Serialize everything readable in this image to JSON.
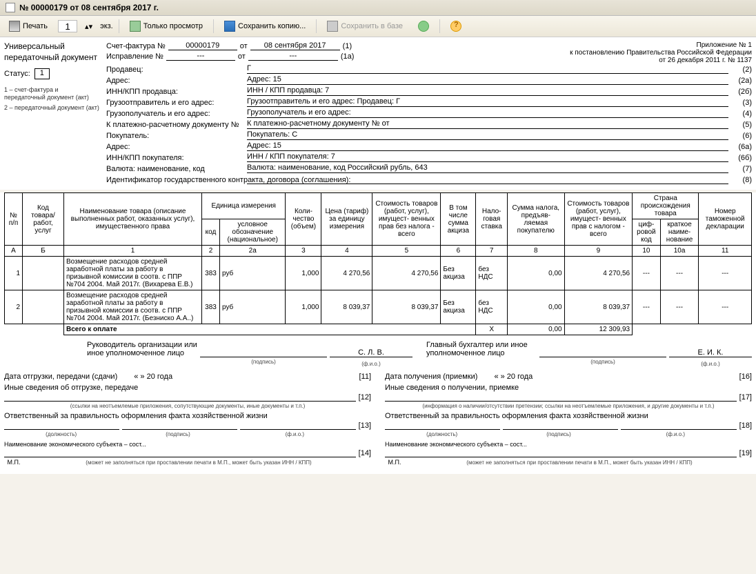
{
  "window": {
    "title": "№ 00000179 от 08 сентября 2017 г."
  },
  "toolbar": {
    "print": "Печать",
    "copies": "1",
    "copies_unit": "экз.",
    "view_only": "Только просмотр",
    "save_copy": "Сохранить копию...",
    "save_db": "Сохранить в базе"
  },
  "left": {
    "title": "Универсальный передаточный документ",
    "status_label": "Статус:",
    "status_value": "1",
    "note1": "1 – счет-фактура и передаточный документ (акт)",
    "note2": "2 – передаточный документ (акт)"
  },
  "header": {
    "invoice_label": "Счет-фактура №",
    "invoice_no": "00000179",
    "from": "от",
    "invoice_date": "08 сентября 2017",
    "invoice_suffix": "(1)",
    "correction_label": "Исправление №",
    "correction_no": "---",
    "correction_date": "---",
    "correction_suffix": "(1а)",
    "attach1": "Приложение № 1",
    "attach2": "к постановлению Правительства Российской Федерации",
    "attach3": "от 26 декабря 2011 г. № 1137"
  },
  "fields": {
    "seller": {
      "label": "Продавец:",
      "value": "Г",
      "suffix": "(2)"
    },
    "address": {
      "label": "Адрес:",
      "value": "Адрес: 15",
      "suffix": "(2а)"
    },
    "inn_seller": {
      "label": "ИНН/КПП продавца:",
      "value": "ИНН / КПП продавца: 7",
      "suffix": "(2б)"
    },
    "shipper": {
      "label": "Грузоотправитель и его адрес:",
      "value": "Грузоотправитель и его адрес: Продавец: Г",
      "suffix": "(3)"
    },
    "consignee": {
      "label": "Грузополучатель и его адрес:",
      "value": "Грузополучатель и его адрес:",
      "suffix": "(4)"
    },
    "paydoc": {
      "label": "К платежно-расчетному документу №",
      "value": "К платежно-расчетному документу №                              от",
      "suffix": "(5)"
    },
    "buyer": {
      "label": "Покупатель:",
      "value": "Покупатель: С",
      "suffix": "(6)"
    },
    "buyer_addr": {
      "label": "Адрес:",
      "value": "Адрес: 15",
      "suffix": "(6а)"
    },
    "inn_buyer": {
      "label": "ИНН/КПП покупателя:",
      "value": "ИНН / КПП покупателя: 7",
      "suffix": "(6б)"
    },
    "currency": {
      "label": "Валюта: наименование, код",
      "value": "Валюта: наименование, код Российский рубль, 643",
      "suffix": "(7)"
    },
    "contract": {
      "label": "Идентификатор государственного контракта, договора (соглашения):",
      "value": "",
      "suffix": "(8)"
    }
  },
  "table": {
    "headers": {
      "a": "№ п/п",
      "b": "Код товара/ работ, услуг",
      "c1": "Наименование товара (описание выполненных работ, оказанных услуг), имущественного права",
      "c2": "Единица измерения",
      "c2a": "код",
      "c2b": "условное обозначение (национальное)",
      "c3": "Коли- чество (объем)",
      "c4": "Цена (тариф) за единицу измерения",
      "c5": "Стоимость товаров (работ, услуг), имущест- венных прав без налога - всего",
      "c6": "В том числе сумма акциза",
      "c7": "Нало- говая ставка",
      "c8": "Сумма налога, предъяв- ляемая покупателю",
      "c9": "Стоимость товаров (работ, услуг), имущест- венных прав с налогом - всего",
      "c10g": "Страна происхождения товара",
      "c10": "циф- ровой код",
      "c10a": "краткое наиме- нование",
      "c11": "Номер таможенной декларации"
    },
    "numrow": {
      "a": "А",
      "b": "Б",
      "c1": "1",
      "c2": "2",
      "c2a": "2а",
      "c3": "3",
      "c4": "4",
      "c5": "5",
      "c6": "6",
      "c7": "7",
      "c8": "8",
      "c9": "9",
      "c10": "10",
      "c10a": "10а",
      "c11": "11"
    },
    "rows": [
      {
        "n": "1",
        "code": "",
        "name": "Возмещение расходов средней заработной платы за работу в призывной комиссии в соотв. с ППР №704 2004. Май 2017г. (Вихарева Е.В.)",
        "ucode": "383",
        "uname": "руб",
        "qty": "1,000",
        "price": "4 270,56",
        "sum_no_tax": "4 270,56",
        "excise": "Без акциза",
        "rate": "без НДС",
        "tax": "0,00",
        "sum_tax": "4 270,56",
        "ccode": "---",
        "cname": "---",
        "decl": "---"
      },
      {
        "n": "2",
        "code": "",
        "name": "Возмещение расходов средней заработной платы за работу в призывной комиссии в соотв. с ППР №704 2004. Май 2017г. (Безниско А.А..)",
        "ucode": "383",
        "uname": "руб",
        "qty": "1,000",
        "price": "8 039,37",
        "sum_no_tax": "8 039,37",
        "excise": "Без акциза",
        "rate": "без НДС",
        "tax": "0,00",
        "sum_tax": "8 039,37",
        "ccode": "---",
        "cname": "---",
        "decl": "---"
      }
    ],
    "total": {
      "label": "Всего к оплате",
      "x": "Х",
      "tax": "0,00",
      "sum": "12 309,93"
    }
  },
  "sign": {
    "rukovod": "Руководитель организации или иное уполномоченное лицо",
    "rukovod_fio": "С. Л. В.",
    "glavbuh": "Главный бухгалтер или иное уполномоченное лицо",
    "glavbuh_fio": "Е. И. К.",
    "podpis": "(подпись)",
    "fio": "(ф.и.о.)",
    "ship_date": "Дата отгрузки, передачи (сдачи)",
    "recv_date": "Дата получения (приемки)",
    "date_tpl": "«         »                         20      года",
    "n11": "[11]",
    "n16": "[16]",
    "other_ship": "Иные сведения об отгрузке, передаче",
    "other_recv": "Иные сведения о получении, приемке",
    "hint_ship": "(ссылки на неотъемлемые приложения, сопутствующие документы, иные документы и т.п.)",
    "hint_recv": "(информация о наличии/отсутствии претензии; ссылки на неотъемлемые приложения, и  другие  документы и т.п.)",
    "resp": "Ответственный за правильность оформления факта хозяйственной жизни",
    "n12": "[12]",
    "n17": "[17]",
    "n13": "[13]",
    "n18": "[18]",
    "n14": "[14]",
    "n19": "[19]",
    "dolzh": "(должность)",
    "mp": "М.П.",
    "mp_hint": "(может не заполняться при проставлении печати в М.П., может быть указан ИНН / КПП)",
    "econ": "Наименование экономического субъекта – сост..."
  }
}
